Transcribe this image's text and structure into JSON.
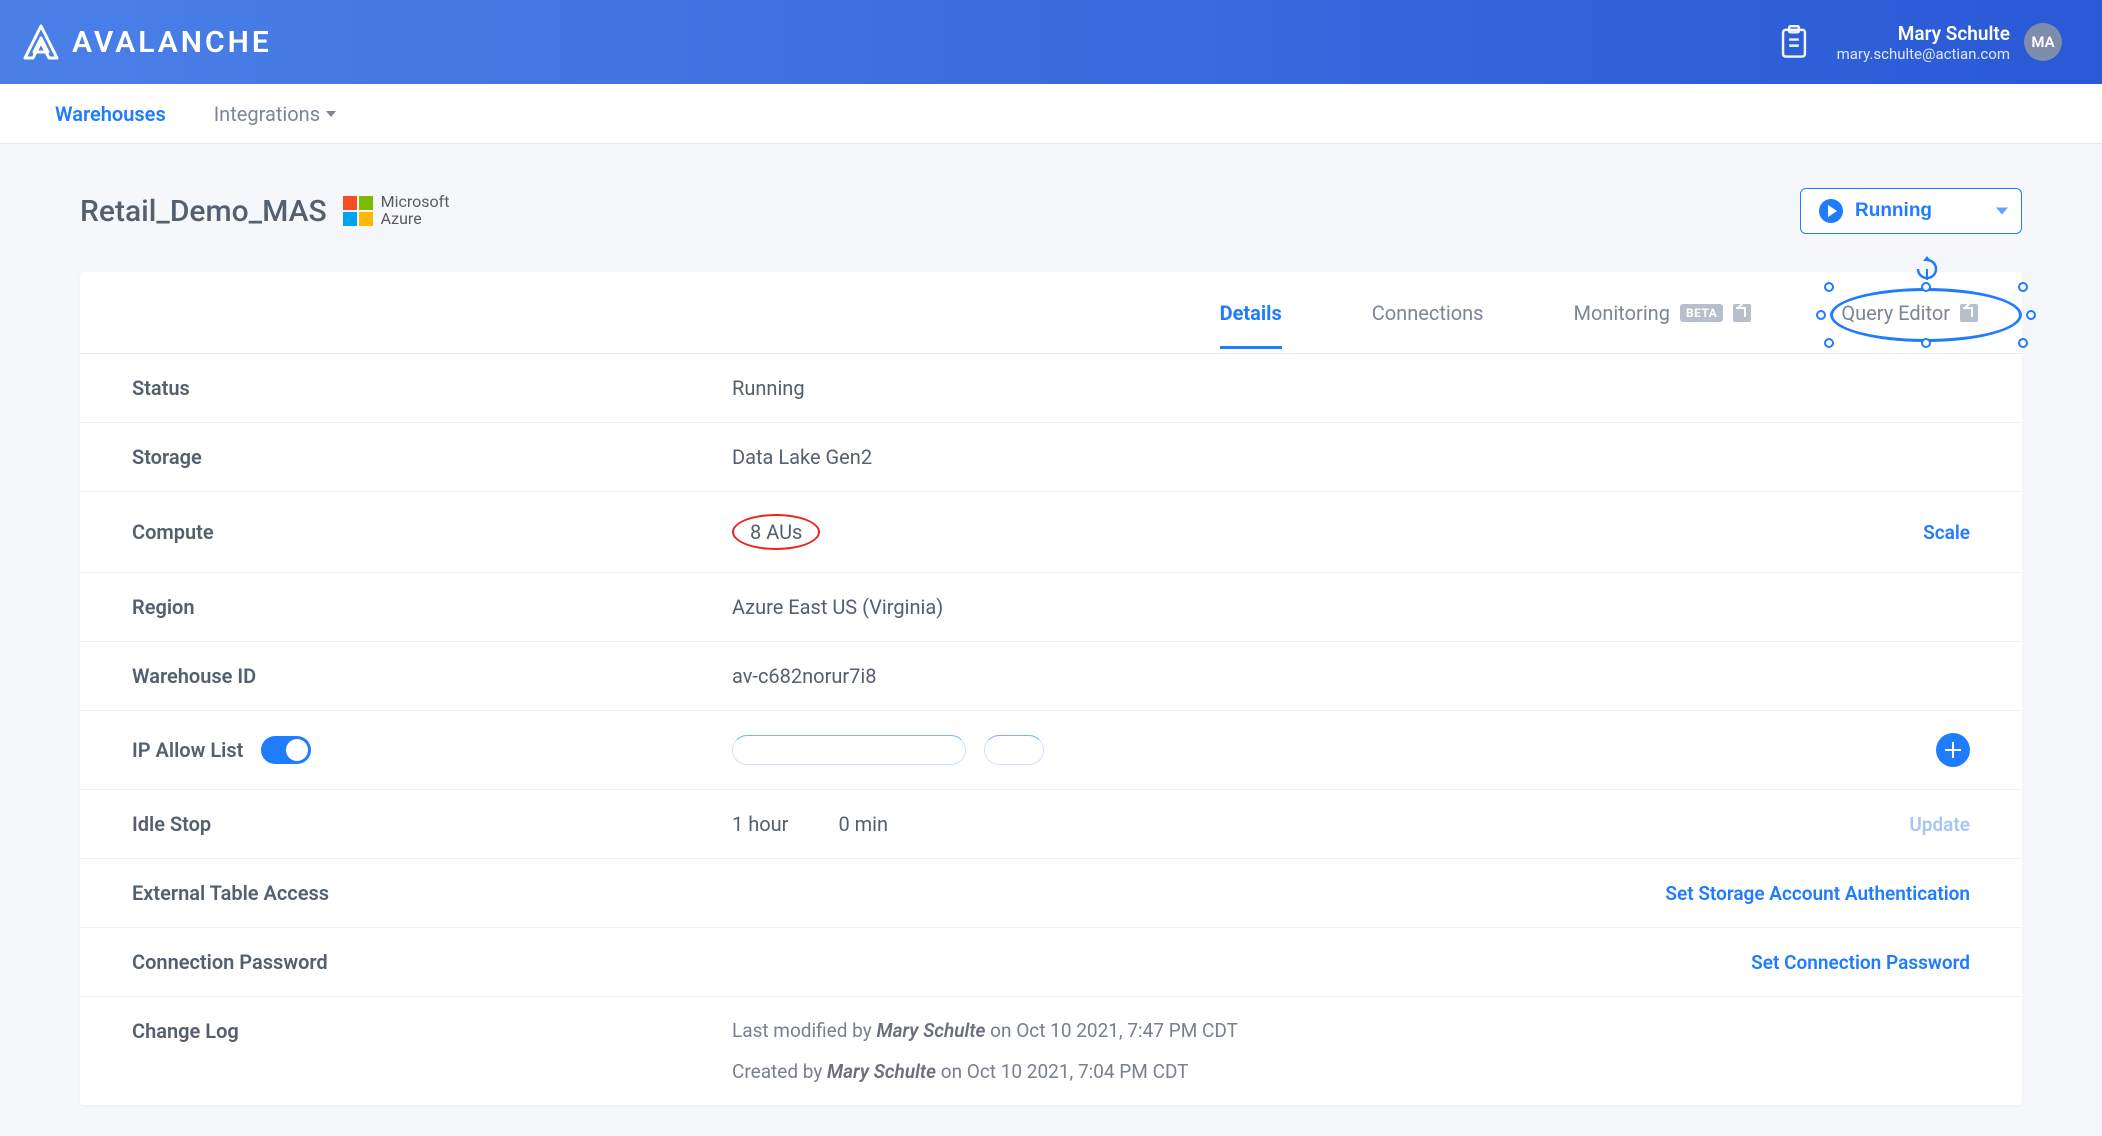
{
  "brand": {
    "name": "AVALANCHE"
  },
  "user": {
    "name": "Mary Schulte",
    "email": "mary.schulte@actian.com",
    "initials": "MA"
  },
  "nav": {
    "warehouses": "Warehouses",
    "integrations": "Integrations"
  },
  "warehouse": {
    "name": "Retail_Demo_MAS",
    "cloud": {
      "vendor_line1": "Microsoft",
      "vendor_line2": "Azure"
    }
  },
  "status_btn": "Running",
  "tabs": {
    "details": "Details",
    "connections": "Connections",
    "monitoring": "Monitoring",
    "monitoring_badge": "BETA",
    "query_editor": "Query Editor"
  },
  "labels": {
    "status": "Status",
    "storage": "Storage",
    "compute": "Compute",
    "region": "Region",
    "warehouse_id": "Warehouse ID",
    "ip_allow": "IP Allow List",
    "idle_stop": "Idle Stop",
    "ext_table": "External Table Access",
    "conn_pwd": "Connection Password",
    "changelog": "Change Log"
  },
  "values": {
    "status": "Running",
    "storage": "Data Lake Gen2",
    "compute": "8 AUs",
    "region": "Azure East US (Virginia)",
    "warehouse_id": "av-c682norur7i8",
    "idle_hour": "1 hour",
    "idle_min": "0 min"
  },
  "actions": {
    "scale": "Scale",
    "update": "Update",
    "set_storage_auth": "Set Storage Account Authentication",
    "set_conn_pwd": "Set Connection Password"
  },
  "changelog": {
    "modified_prefix": "Last modified by ",
    "modified_by": "Mary Schulte",
    "modified_suffix": " on Oct 10 2021, 7:47 PM CDT",
    "created_prefix": "Created by ",
    "created_by": "Mary Schulte",
    "created_suffix": " on Oct 10 2021, 7:04 PM CDT"
  }
}
